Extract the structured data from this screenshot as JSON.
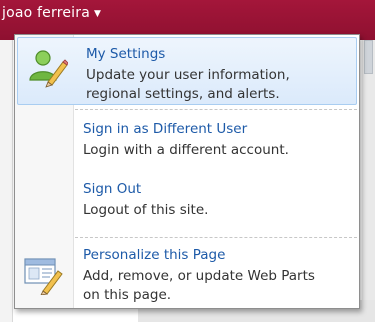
{
  "header": {
    "username": "joao ferreira"
  },
  "menu": {
    "items": [
      {
        "title": "My Settings",
        "desc_lines": [
          "Update your user information,",
          "regional settings, and alerts."
        ]
      },
      {
        "title": "Sign in as Different User",
        "desc_lines": [
          "Login with a different account."
        ]
      },
      {
        "title": "Sign Out",
        "desc_lines": [
          "Logout of this site."
        ]
      },
      {
        "title": "Personalize this Page",
        "desc_lines": [
          "Add, remove, or update Web Parts",
          "on this page."
        ]
      }
    ]
  },
  "colors": {
    "title_link": "#1d5aa8",
    "highlight": "#dbeafb",
    "topbar": "#8e1030"
  },
  "icons": [
    "user-edit-icon",
    "page-edit-icon",
    "chevron-down-icon"
  ]
}
